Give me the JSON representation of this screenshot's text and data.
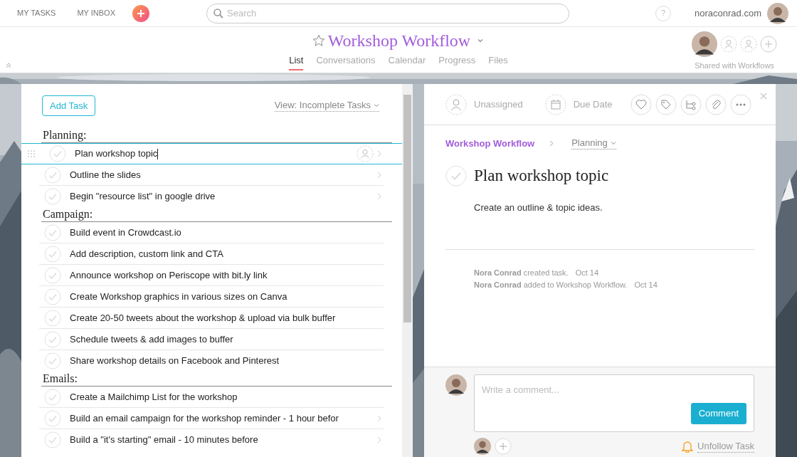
{
  "topbar": {
    "nav": [
      "MY TASKS",
      "MY INBOX"
    ],
    "search": {
      "placeholder": "Search"
    },
    "help": "?",
    "account": "noraconrad.com"
  },
  "project": {
    "title": "Workshop Workflow",
    "starred": false,
    "tabs": [
      {
        "label": "List",
        "selected": true
      },
      {
        "label": "Conversations",
        "selected": false
      },
      {
        "label": "Calendar",
        "selected": false
      },
      {
        "label": "Progress",
        "selected": false
      },
      {
        "label": "Files",
        "selected": false
      }
    ],
    "shared_label": "Shared with Workflows"
  },
  "list": {
    "add_button": "Add Task",
    "view_filter": "View: Incomplete Tasks",
    "sections": [
      {
        "name": "Planning:",
        "tasks": [
          {
            "name": "Plan workshop topic",
            "selected": true,
            "chevron": true
          },
          {
            "name": "Outline the slides",
            "selected": false,
            "chevron": true
          },
          {
            "name": "Begin \"resource list\" in google drive",
            "selected": false,
            "chevron": true
          }
        ]
      },
      {
        "name": "Campaign:",
        "tasks": [
          {
            "name": "Build event in Crowdcast.io",
            "selected": false,
            "chevron": false
          },
          {
            "name": "Add description, custom link and CTA",
            "selected": false,
            "chevron": false
          },
          {
            "name": "Announce workshop on Periscope with bit.ly link",
            "selected": false,
            "chevron": false
          },
          {
            "name": "Create Workshop graphics in various sizes on Canva",
            "selected": false,
            "chevron": false
          },
          {
            "name": "Create 20-50 tweets about the workshop & upload via bulk buffer",
            "selected": false,
            "chevron": false
          },
          {
            "name": "Schedule tweets & add images to buffer",
            "selected": false,
            "chevron": false
          },
          {
            "name": "Share workshop details on Facebook and Pinterest",
            "selected": false,
            "chevron": false
          }
        ]
      },
      {
        "name": "Emails:",
        "tasks": [
          {
            "name": "Create a Mailchimp List for the workshop",
            "selected": false,
            "chevron": false
          },
          {
            "name": "Build an email campaign for the workshop reminder - 1 hour befor",
            "selected": false,
            "chevron": true
          },
          {
            "name": "Build a \"it's starting\" email - 10 minutes before",
            "selected": false,
            "chevron": true
          }
        ]
      }
    ]
  },
  "detail": {
    "assignee": "Unassigned",
    "due_date": "Due Date",
    "project": "Workshop Workflow",
    "section": "Planning",
    "title": "Plan workshop topic",
    "completed": false,
    "description": "Create an outline & topic ideas.",
    "activity": [
      {
        "text": "**Nora Conrad** created task.",
        "date": "Oct 14"
      },
      {
        "text": "**Nora Conrad** added to Workshop Workflow.",
        "date": "Oct 14"
      }
    ],
    "comment": {
      "placeholder": "Write a comment...",
      "button": "Comment"
    },
    "unfollow": "Unfollow Task"
  }
}
